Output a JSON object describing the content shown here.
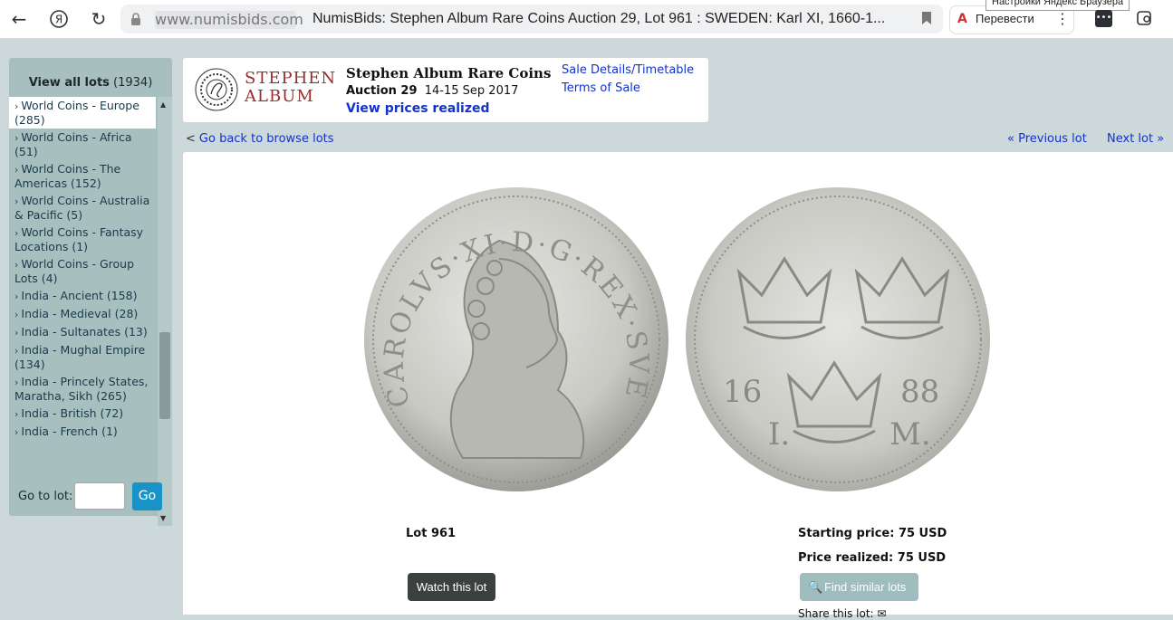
{
  "browser": {
    "domain": "www.numisbids.com",
    "page_title": "NumisBids: Stephen Album Rare Coins Auction 29, Lot 961 : SWEDEN: Karl XI, 1660-1...",
    "translate_label": "Перевести",
    "tooltip": "Настройки Яндекс Браузера",
    "yandex_glyph": "Я"
  },
  "sidebar": {
    "view_all_label": "View all lots",
    "view_all_count": "(1934)",
    "categories": [
      {
        "label": "World Coins - Europe (285)"
      },
      {
        "label": "World Coins - Africa (51)"
      },
      {
        "label": "World Coins - The Americas (152)"
      },
      {
        "label": "World Coins - Australia & Pacific (5)"
      },
      {
        "label": "World Coins - Fantasy Locations (1)"
      },
      {
        "label": "World Coins - Group Lots (4)"
      },
      {
        "label": "India - Ancient (158)"
      },
      {
        "label": "India - Medieval (28)"
      },
      {
        "label": "India - Sultanates (13)"
      },
      {
        "label": "India - Mughal Empire (134)"
      },
      {
        "label": "India - Princely States, Maratha, Sikh (265)"
      },
      {
        "label": "India - British (72)"
      },
      {
        "label": "India - French (1)"
      }
    ],
    "goto_label": "Go to lot:",
    "go_button": "Go"
  },
  "header": {
    "logo_line1": "STEPHEN",
    "logo_line2": "ALBUM",
    "auction_house": "Stephen Album Rare Coins",
    "auction_number": "Auction 29",
    "auction_dates": "14-15 Sep 2017",
    "prices_link": "View prices realized",
    "sale_details_link": "Sale Details/Timetable",
    "terms_link": "Terms of Sale"
  },
  "navigation": {
    "back_prefix": "<",
    "back_link": "Go back to browse lots",
    "prev_link": "« Previous lot",
    "next_link": "Next lot »"
  },
  "lot": {
    "lot_label": "Lot 961",
    "starting_price": "Starting price: 75 USD",
    "price_realized": "Price realized: 75 USD",
    "watch_button": "Watch this lot",
    "similar_button": "Find similar lots",
    "share_label": "Share this lot:",
    "coin_obverse_legend": "CAROLVS·XI·D·G·REX·SVE",
    "coin_reverse_year_left": "16",
    "coin_reverse_year_right": "88",
    "coin_reverse_mint_left": "I.",
    "coin_reverse_mint_right": "M."
  }
}
